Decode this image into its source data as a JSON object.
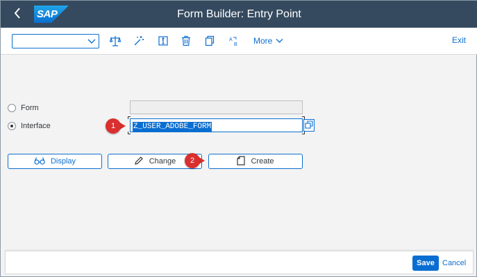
{
  "shell": {
    "logo_text": "SAP",
    "title": "Form Builder: Entry Point",
    "back_icon": "chevron-left-icon",
    "colors": {
      "shell_bg": "#354a5f",
      "accent": "#0a6ed1",
      "callout": "#d9302f"
    }
  },
  "toolbar": {
    "command_field_value": "",
    "icons": [
      "compare-icon",
      "magic-wand-icon",
      "info-icon",
      "delete-icon",
      "copy-icon",
      "rename-icon"
    ],
    "more_label": "More",
    "exit_label": "Exit"
  },
  "selection": {
    "form_label": "Form",
    "interface_label": "Interface",
    "selected": "interface",
    "form_value": "",
    "interface_value": "Z_USER_ADOBE_FORM"
  },
  "actions": {
    "display_label": "Display",
    "change_label": "Change",
    "create_label": "Create"
  },
  "callouts": [
    "1",
    "2"
  ],
  "footer": {
    "save_label": "Save",
    "cancel_label": "Cancel"
  }
}
